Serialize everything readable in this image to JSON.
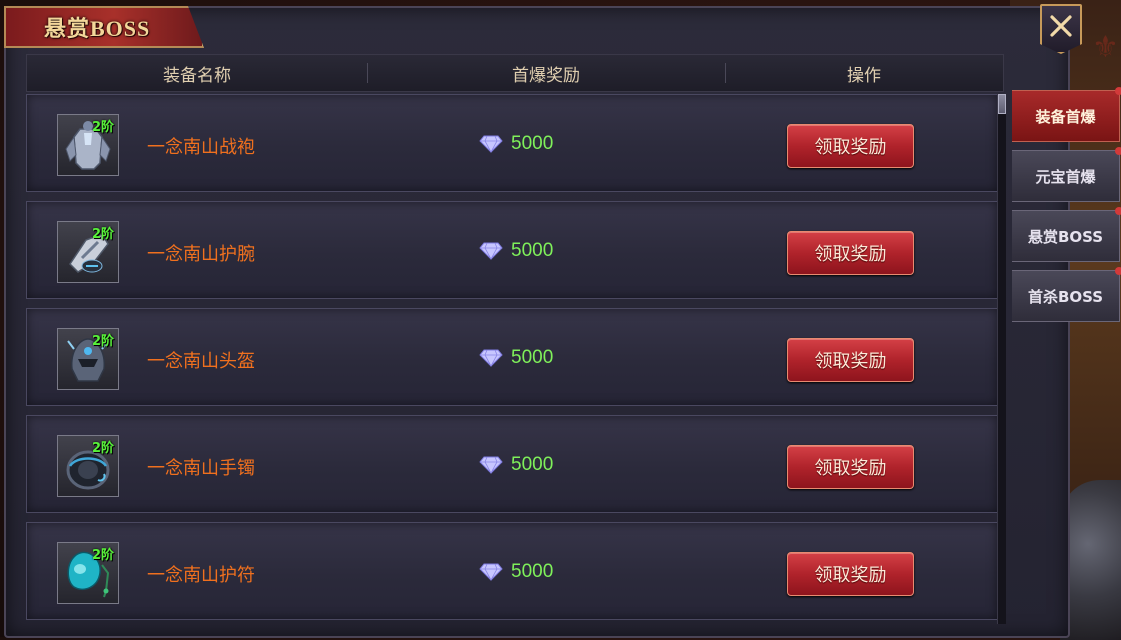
{
  "window": {
    "title": "悬赏BOSS"
  },
  "table": {
    "headers": [
      "装备名称",
      "首爆奖励",
      "操作"
    ],
    "rows": [
      {
        "tier": "2阶",
        "name": "一念南山战袍",
        "reward": "5000",
        "action": "领取奖励",
        "icon": "armor-icon"
      },
      {
        "tier": "2阶",
        "name": "一念南山护腕",
        "reward": "5000",
        "action": "领取奖励",
        "icon": "bracer-icon"
      },
      {
        "tier": "2阶",
        "name": "一念南山头盔",
        "reward": "5000",
        "action": "领取奖励",
        "icon": "helmet-icon"
      },
      {
        "tier": "2阶",
        "name": "一念南山手镯",
        "reward": "5000",
        "action": "领取奖励",
        "icon": "bracelet-icon"
      },
      {
        "tier": "2阶",
        "name": "一念南山护符",
        "reward": "5000",
        "action": "领取奖励",
        "icon": "amulet-icon"
      }
    ]
  },
  "side_tabs": [
    {
      "label": "装备首爆",
      "active": true
    },
    {
      "label": "元宝首爆",
      "active": false
    },
    {
      "label": "悬赏BOSS",
      "active": false
    },
    {
      "label": "首杀BOSS",
      "active": false
    }
  ],
  "colors": {
    "item_name": "#f0701e",
    "reward": "#7ff05a",
    "tier": "#58f23a",
    "claim_button": "#b0232b",
    "title": "#f3d79a"
  }
}
